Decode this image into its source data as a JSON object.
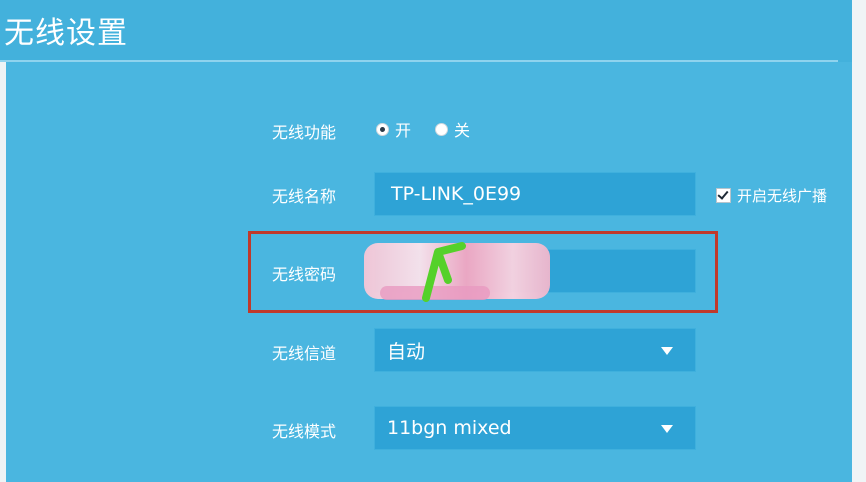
{
  "header": {
    "title": "无线设置"
  },
  "wireless_function": {
    "label": "无线功能",
    "options": [
      {
        "label": "开",
        "selected": true
      },
      {
        "label": "关",
        "selected": false
      }
    ]
  },
  "wireless_name": {
    "label": "无线名称",
    "value": "TP-LINK_0E99",
    "broadcast_checkbox_label": "开启无线广播",
    "broadcast_checked": true
  },
  "wireless_password": {
    "label": "无线密码"
  },
  "wireless_channel": {
    "label": "无线信道",
    "value": "自动"
  },
  "wireless_mode": {
    "label": "无线模式",
    "value": "11bgn mixed"
  },
  "colors": {
    "background": "#4ab6e0",
    "field": "#2ea3d6",
    "highlight": "#c0392b"
  }
}
